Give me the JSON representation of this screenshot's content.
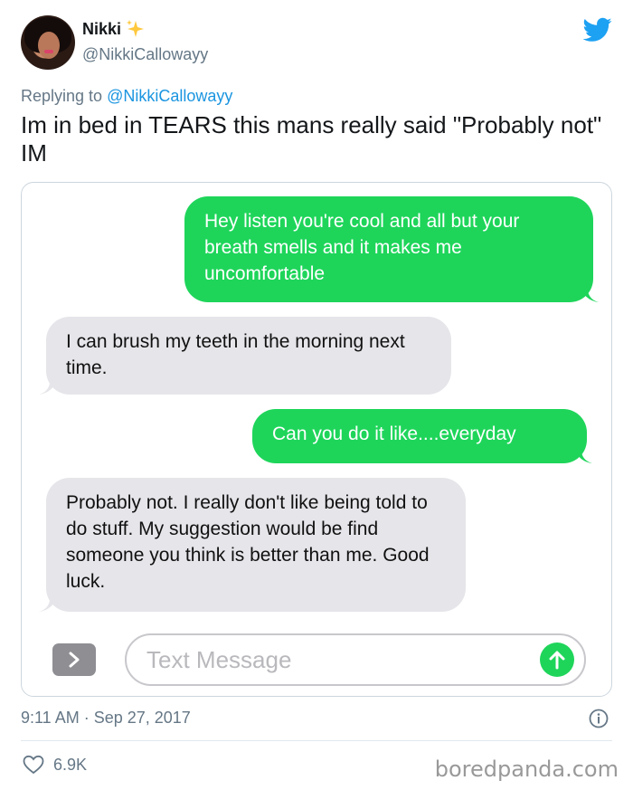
{
  "author": {
    "display_name": "Nikki",
    "handle": "@NikkiCallowayy"
  },
  "reply": {
    "prefix": "Replying to ",
    "to": "@NikkiCallowayy"
  },
  "tweet": {
    "text": "Im in bed in TEARS this mans really said \"Probably not\" IM",
    "timestamp": "9:11 AM · Sep 27, 2017",
    "likes": "6.9K"
  },
  "screenshot": {
    "messages": [
      {
        "sender": "me",
        "text": "Hey listen you're cool and all but your breath smells and it makes me uncomfortable"
      },
      {
        "sender": "them",
        "text": "I can brush my teeth in the morning next time."
      },
      {
        "sender": "me",
        "text": "Can you do it like....everyday"
      },
      {
        "sender": "them",
        "text": "Probably not.  I really don't like being told to do stuff.  My suggestion would be find someone you think is better than me.  Good luck."
      }
    ],
    "compose_placeholder": "Text Message"
  },
  "watermark": "boredpanda.com",
  "colors": {
    "sent_bubble": "#1ed55a",
    "received_bubble": "#e5e5ea",
    "twitter_blue": "#1da1f2",
    "link": "#1b95e0"
  },
  "icons": [
    "sparkle-icon",
    "twitter-bird-icon",
    "info-icon",
    "heart-icon",
    "chevron-right-icon",
    "arrow-up-icon"
  ]
}
